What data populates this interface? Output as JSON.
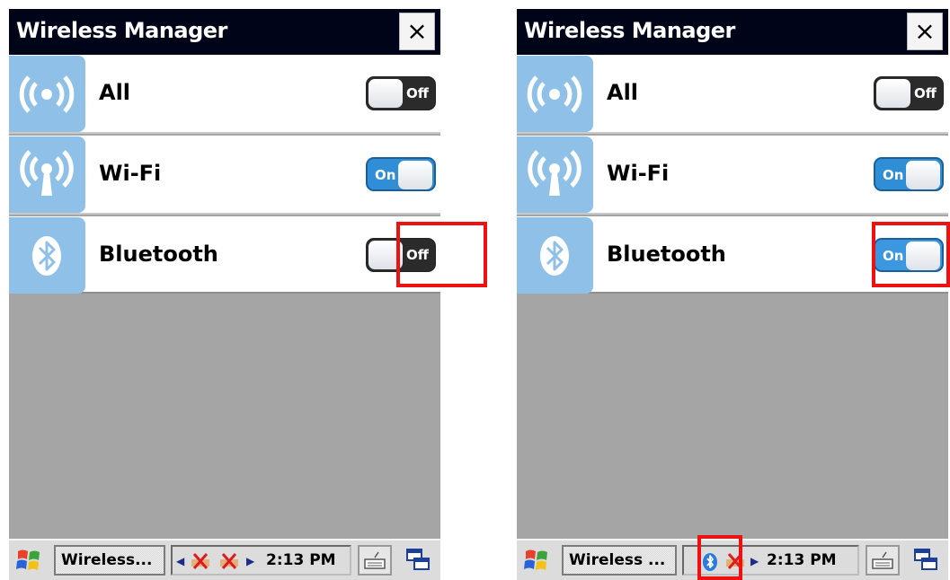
{
  "left_screen": {
    "window_title": "Wireless Manager",
    "close_label": "×",
    "rows": [
      {
        "label": "All",
        "state": "Off",
        "icon": "wireless-broadcast-icon"
      },
      {
        "label": "Wi-Fi",
        "state": "On",
        "icon": "wifi-antenna-icon"
      },
      {
        "label": "Bluetooth",
        "state": "Off",
        "icon": "bluetooth-icon"
      }
    ],
    "taskbar": {
      "task_label": "Wireless...",
      "clock": "2:13 PM",
      "tray_icons": [
        "wifi-disconnected-icon",
        "network-disconnected-icon"
      ]
    }
  },
  "right_screen": {
    "window_title": "Wireless Manager",
    "close_label": "×",
    "rows": [
      {
        "label": "All",
        "state": "Off",
        "icon": "wireless-broadcast-icon"
      },
      {
        "label": "Wi-Fi",
        "state": "On",
        "icon": "wifi-antenna-icon"
      },
      {
        "label": "Bluetooth",
        "state": "On",
        "icon": "bluetooth-icon"
      }
    ],
    "taskbar": {
      "task_label": "Wireless ...",
      "clock": "2:13 PM",
      "tray_icons": [
        "bluetooth-tray-icon",
        "network-disconnected-icon"
      ]
    }
  },
  "colors": {
    "titlebar": "#000418",
    "icon_tile": "#8fc1e8",
    "toggle_on": "#2f8ed6",
    "toggle_off": "#2b2b2b",
    "highlight": "#ee1111",
    "empty_area": "#a5a5a5"
  }
}
